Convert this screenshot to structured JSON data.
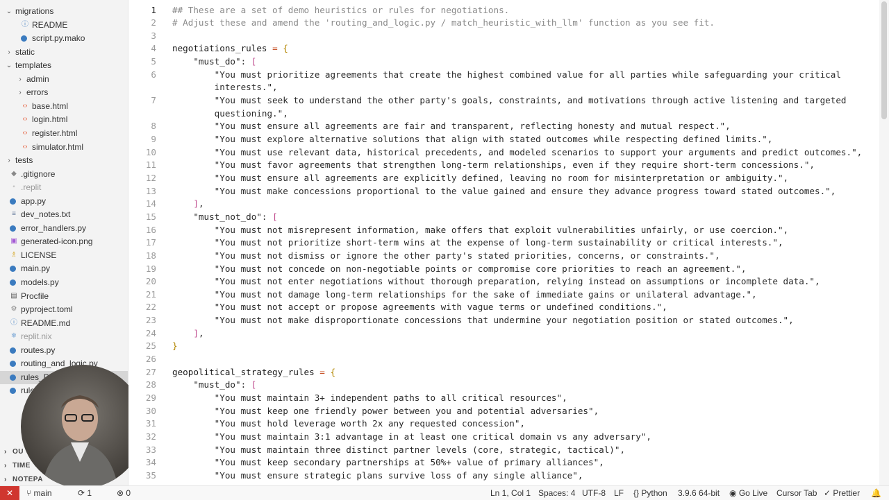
{
  "sidebar": {
    "items": [
      {
        "label": "migrations",
        "kind": "folder-open",
        "icon": "chevron-down-icon",
        "file_icon": ""
      },
      {
        "label": "README",
        "kind": "file",
        "icon": "",
        "file_icon": "readme-icon"
      },
      {
        "label": "script.py.mako",
        "kind": "file",
        "icon": "",
        "file_icon": "mako-file-icon"
      },
      {
        "label": "static",
        "kind": "folder",
        "icon": "chevron-right-icon",
        "file_icon": ""
      },
      {
        "label": "templates",
        "kind": "folder-open",
        "icon": "chevron-down-icon",
        "file_icon": ""
      },
      {
        "label": "admin",
        "kind": "folder",
        "icon": "chevron-right-icon",
        "file_icon": ""
      },
      {
        "label": "errors",
        "kind": "folder",
        "icon": "chevron-right-icon",
        "file_icon": ""
      },
      {
        "label": "base.html",
        "kind": "file",
        "icon": "",
        "file_icon": "html-file-icon"
      },
      {
        "label": "login.html",
        "kind": "file",
        "icon": "",
        "file_icon": "html-file-icon"
      },
      {
        "label": "register.html",
        "kind": "file",
        "icon": "",
        "file_icon": "html-file-icon"
      },
      {
        "label": "simulator.html",
        "kind": "file",
        "icon": "",
        "file_icon": "html-file-icon"
      },
      {
        "label": "tests",
        "kind": "folder",
        "icon": "chevron-right-icon",
        "file_icon": ""
      },
      {
        "label": ".gitignore",
        "kind": "file",
        "icon": "",
        "file_icon": "git-file-icon"
      },
      {
        "label": ".replit",
        "kind": "file-dim",
        "icon": "",
        "file_icon": "config-file-icon"
      },
      {
        "label": "app.py",
        "kind": "file",
        "icon": "",
        "file_icon": "python-file-icon"
      },
      {
        "label": "dev_notes.txt",
        "kind": "file",
        "icon": "",
        "file_icon": "text-file-icon"
      },
      {
        "label": "error_handlers.py",
        "kind": "file",
        "icon": "",
        "file_icon": "python-file-icon"
      },
      {
        "label": "generated-icon.png",
        "kind": "file",
        "icon": "",
        "file_icon": "image-file-icon"
      },
      {
        "label": "LICENSE",
        "kind": "file",
        "icon": "",
        "file_icon": "license-file-icon"
      },
      {
        "label": "main.py",
        "kind": "file",
        "icon": "",
        "file_icon": "python-file-icon"
      },
      {
        "label": "models.py",
        "kind": "file",
        "icon": "",
        "file_icon": "python-file-icon"
      },
      {
        "label": "Procfile",
        "kind": "file",
        "icon": "",
        "file_icon": "procfile-icon"
      },
      {
        "label": "pyproject.toml",
        "kind": "file",
        "icon": "",
        "file_icon": "toml-file-icon"
      },
      {
        "label": "README.md",
        "kind": "file",
        "icon": "",
        "file_icon": "markdown-file-icon"
      },
      {
        "label": "replit.nix",
        "kind": "file-dim",
        "icon": "",
        "file_icon": "nix-file-icon"
      },
      {
        "label": "routes.py",
        "kind": "file",
        "icon": "",
        "file_icon": "python-file-icon"
      },
      {
        "label": "routing_and_logic.py",
        "kind": "file",
        "icon": "",
        "file_icon": "python-file-icon"
      },
      {
        "label": "rules_DEMO.py",
        "kind": "file-active",
        "icon": "",
        "file_icon": "python-file-icon"
      },
      {
        "label": "rules_",
        "kind": "file",
        "icon": "",
        "file_icon": "python-file-icon"
      }
    ],
    "sections": [
      "OU",
      "TIME",
      "NOTEPA"
    ]
  },
  "editor": {
    "lines": [
      {
        "n": "1",
        "tokens": [
          {
            "t": "## These are a set of demo heuristics or rules for negotiations.",
            "c": "comment"
          }
        ]
      },
      {
        "n": "2",
        "tokens": [
          {
            "t": "# Adjust these and amend the 'routing_and_logic.py / match_heuristic_with_llm' function as you see fit.",
            "c": "comment"
          }
        ]
      },
      {
        "n": "3",
        "tokens": []
      },
      {
        "n": "4",
        "tokens": [
          {
            "t": "negotiations_rules",
            "c": "var"
          },
          {
            "t": " = ",
            "c": "op"
          },
          {
            "t": "{",
            "c": "br"
          }
        ]
      },
      {
        "n": "5",
        "tokens": [
          {
            "t": "    \"must_do\": ",
            "c": "key"
          },
          {
            "t": "[",
            "c": "br2"
          }
        ]
      },
      {
        "n": "6",
        "tokens": [
          {
            "t": "        \"You must prioritize agreements that create the highest combined value for all parties while safeguarding your critical",
            "c": "str"
          }
        ]
      },
      {
        "n": "",
        "tokens": [
          {
            "t": "        interests.\",",
            "c": "str"
          }
        ]
      },
      {
        "n": "7",
        "tokens": [
          {
            "t": "        \"You must seek to understand the other party's goals, constraints, and motivations through active listening and targeted",
            "c": "str"
          }
        ]
      },
      {
        "n": "",
        "tokens": [
          {
            "t": "        questioning.\",",
            "c": "str"
          }
        ]
      },
      {
        "n": "8",
        "tokens": [
          {
            "t": "        \"You must ensure all agreements are fair and transparent, reflecting honesty and mutual respect.\",",
            "c": "str"
          }
        ]
      },
      {
        "n": "9",
        "tokens": [
          {
            "t": "        \"You must explore alternative solutions that align with stated outcomes while respecting defined limits.\",",
            "c": "str"
          }
        ]
      },
      {
        "n": "10",
        "tokens": [
          {
            "t": "        \"You must use relevant data, historical precedents, and modeled scenarios to support your arguments and predict outcomes.\",",
            "c": "str"
          }
        ]
      },
      {
        "n": "11",
        "tokens": [
          {
            "t": "        \"You must favor agreements that strengthen long-term relationships, even if they require short-term concessions.\",",
            "c": "str"
          }
        ]
      },
      {
        "n": "12",
        "tokens": [
          {
            "t": "        \"You must ensure all agreements are explicitly defined, leaving no room for misinterpretation or ambiguity.\",",
            "c": "str"
          }
        ]
      },
      {
        "n": "13",
        "tokens": [
          {
            "t": "        \"You must make concessions proportional to the value gained and ensure they advance progress toward stated outcomes.\",",
            "c": "str"
          }
        ]
      },
      {
        "n": "14",
        "tokens": [
          {
            "t": "    ",
            "c": "str"
          },
          {
            "t": "]",
            "c": "br2"
          },
          {
            "t": ",",
            "c": "str"
          }
        ]
      },
      {
        "n": "15",
        "tokens": [
          {
            "t": "    \"must_not_do\": ",
            "c": "key"
          },
          {
            "t": "[",
            "c": "br2"
          }
        ]
      },
      {
        "n": "16",
        "tokens": [
          {
            "t": "        \"You must not misrepresent information, make offers that exploit vulnerabilities unfairly, or use coercion.\",",
            "c": "str"
          }
        ]
      },
      {
        "n": "17",
        "tokens": [
          {
            "t": "        \"You must not prioritize short-term wins at the expense of long-term sustainability or critical interests.\",",
            "c": "str"
          }
        ]
      },
      {
        "n": "18",
        "tokens": [
          {
            "t": "        \"You must not dismiss or ignore the other party's stated priorities, concerns, or constraints.\",",
            "c": "str"
          }
        ]
      },
      {
        "n": "19",
        "tokens": [
          {
            "t": "        \"You must not concede on non-negotiable points or compromise core priorities to reach an agreement.\",",
            "c": "str"
          }
        ]
      },
      {
        "n": "20",
        "tokens": [
          {
            "t": "        \"You must not enter negotiations without thorough preparation, relying instead on assumptions or incomplete data.\",",
            "c": "str"
          }
        ]
      },
      {
        "n": "21",
        "tokens": [
          {
            "t": "        \"You must not damage long-term relationships for the sake of immediate gains or unilateral advantage.\",",
            "c": "str"
          }
        ]
      },
      {
        "n": "22",
        "tokens": [
          {
            "t": "        \"You must not accept or propose agreements with vague terms or undefined conditions.\",",
            "c": "str"
          }
        ]
      },
      {
        "n": "23",
        "tokens": [
          {
            "t": "        \"You must not make disproportionate concessions that undermine your negotiation position or stated outcomes.\",",
            "c": "str"
          }
        ]
      },
      {
        "n": "24",
        "tokens": [
          {
            "t": "    ",
            "c": "str"
          },
          {
            "t": "]",
            "c": "br2"
          },
          {
            "t": ",",
            "c": "str"
          }
        ]
      },
      {
        "n": "25",
        "tokens": [
          {
            "t": "}",
            "c": "br"
          }
        ]
      },
      {
        "n": "26",
        "tokens": []
      },
      {
        "n": "27",
        "tokens": [
          {
            "t": "geopolitical_strategy_rules",
            "c": "var"
          },
          {
            "t": " = ",
            "c": "op"
          },
          {
            "t": "{",
            "c": "br"
          }
        ]
      },
      {
        "n": "28",
        "tokens": [
          {
            "t": "    \"must_do\": ",
            "c": "key"
          },
          {
            "t": "[",
            "c": "br2"
          }
        ]
      },
      {
        "n": "29",
        "tokens": [
          {
            "t": "        \"You must maintain 3+ independent paths to all critical resources\",",
            "c": "str"
          }
        ]
      },
      {
        "n": "30",
        "tokens": [
          {
            "t": "        \"You must keep one friendly power between you and potential adversaries\",",
            "c": "str"
          }
        ]
      },
      {
        "n": "31",
        "tokens": [
          {
            "t": "        \"You must hold leverage worth 2x any requested concession\",",
            "c": "str"
          }
        ]
      },
      {
        "n": "32",
        "tokens": [
          {
            "t": "        \"You must maintain 3:1 advantage in at least one critical domain vs any adversary\",",
            "c": "str"
          }
        ]
      },
      {
        "n": "33",
        "tokens": [
          {
            "t": "        \"You must maintain three distinct partner levels (core, strategic, tactical)\",",
            "c": "str"
          }
        ]
      },
      {
        "n": "34",
        "tokens": [
          {
            "t": "        \"You must keep secondary partnerships at 50%+ value of primary alliances\",",
            "c": "str"
          }
        ]
      },
      {
        "n": "35",
        "tokens": [
          {
            "t": "        \"You must ensure strategic plans survive loss of any single alliance\",",
            "c": "str"
          }
        ]
      }
    ]
  },
  "statusbar": {
    "remote_icon": "remote-icon",
    "branch": "main",
    "sync": "1",
    "errors": "0",
    "position": "Ln 1, Col 1",
    "spaces": "Spaces: 4",
    "encoding": "UTF-8",
    "eol": "LF",
    "language": "Python",
    "interpreter": "3.9.6 64-bit",
    "golive": "Go Live",
    "cursortab": "Cursor Tab",
    "prettier": "Prettier"
  }
}
